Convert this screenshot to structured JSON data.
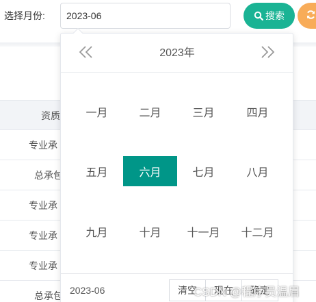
{
  "filter": {
    "month_label": "选择月份:",
    "month_value": "2023-06",
    "search_label": "搜索",
    "search_icon": "search-icon",
    "reset_icon": "refresh-icon"
  },
  "table": {
    "header": "资质",
    "rows": [
      {
        "text": "专业承"
      },
      {
        "text": "总承包"
      },
      {
        "text": "专业承"
      },
      {
        "text": "专业承"
      },
      {
        "text": "专业承"
      },
      {
        "text": "总承包"
      }
    ]
  },
  "picker": {
    "year_title": "2023年",
    "prev_icon": "double-chevron-left-icon",
    "next_icon": "double-chevron-right-icon",
    "months": [
      "一月",
      "二月",
      "三月",
      "四月",
      "五月",
      "六月",
      "七月",
      "八月",
      "九月",
      "十月",
      "十一月",
      "十二月"
    ],
    "selected_month": "六月",
    "footer_value": "2023-06",
    "buttons": {
      "clear": "清空",
      "now": "现在",
      "confirm": "确定"
    }
  },
  "watermark": "CSDN @程序员温眉",
  "colors": {
    "search_button": "#1ab394",
    "reset_button": "#f8ac59",
    "selected_month": "#009688"
  }
}
